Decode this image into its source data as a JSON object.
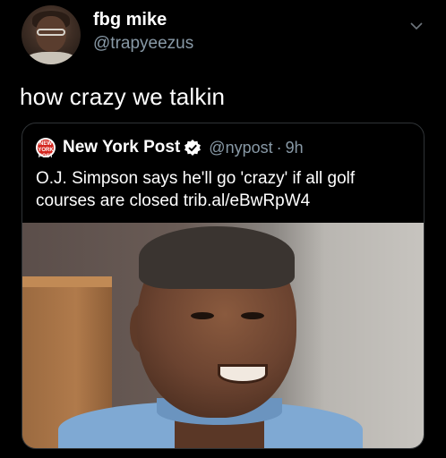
{
  "tweet": {
    "display_name": "fbg mike",
    "handle": "@trapyeezus",
    "text": "how crazy we talkin",
    "menu_icon": "chevron-down-icon"
  },
  "quoted_tweet": {
    "logo_text": "NEW YORK POST",
    "source_name": "New York Post",
    "verified_icon": "verified-badge-icon",
    "handle": "@nypost",
    "separator": "·",
    "time": "9h",
    "text": "O.J. Simpson says he'll go 'crazy' if all golf courses are closed trib.al/eBwRpW4"
  },
  "colors": {
    "background": "#000000",
    "text": "#ffffff",
    "secondary_text": "#8899a6",
    "border": "#2f3336",
    "verified": "#ffffff",
    "nypost_red": "#d4261f"
  }
}
